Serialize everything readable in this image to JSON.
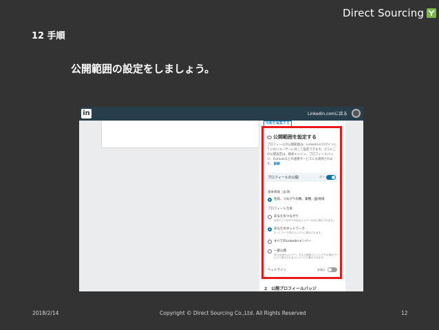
{
  "brand": {
    "name": "Direct Sourcing",
    "logo_color": "#7ab648"
  },
  "slide": {
    "number_label": "12 手順",
    "subtitle": "公開範囲の設定をしましょう。"
  },
  "linkedin": {
    "logo": "in",
    "user_link": "Linkedin.comに戻る",
    "edit_button": "情報を編集する",
    "panel": {
      "title": "公開範囲を設定する",
      "description": "プロフィールの公開範囲は、Linkedinにログインしていないユーザーに対して設定できます。さらにこの公開設定は、検索エンジン、プロフィールバッジ、Outlookなどの連携サービスにも適用されます。",
      "more": "詳細",
      "public_profile_label": "プロフィールの公開",
      "public_toggle_state": "オン",
      "basic_section": "基本情報（必須）",
      "basic_option": "名前、つながりの数、業種、国/地域",
      "photo_section": "プロフィール写真",
      "photo_options": [
        {
          "label": "あなたのつながり",
          "sub": "あなたとつながりのあるメンバーのみに表示されます。",
          "checked": false
        },
        {
          "label": "あなたのネットワーク",
          "sub": "ネットワーク内のメンバーに表示されます。",
          "checked": true
        },
        {
          "label": "すべてのLinkedinメンバー",
          "sub": "",
          "checked": false
        },
        {
          "label": "一部公開",
          "sub": "非Linkedinメンバー、および検索エンジンやその他のサービスで表示されるメンバーにも表示されます。",
          "checked": false
        }
      ],
      "headline_label": "ヘッドライン",
      "headline_toggle_state": "非表示"
    },
    "below_heading": "2　公開プロフィールバッジ"
  },
  "footer": {
    "date": "2018/2/14",
    "copyright": "Copyright © Direct Sourcing Co.,Ltd. All Rights Reserved",
    "page": "12"
  },
  "colors": {
    "background": "#333333",
    "highlight": "#e8191b",
    "linkedin_blue": "#0073b1"
  }
}
